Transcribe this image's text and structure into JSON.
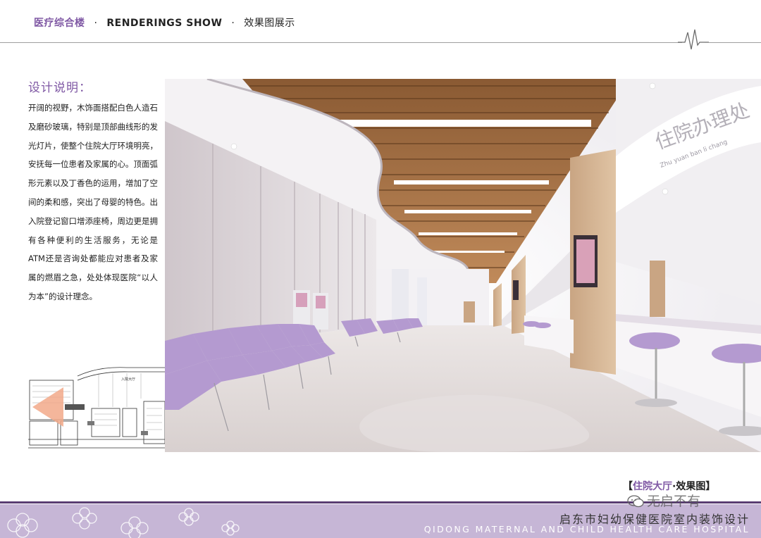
{
  "header": {
    "section_cn": "医疗综合楼",
    "sep1": "·",
    "section_en": "RENDERINGS SHOW",
    "sep2": "·",
    "section_view": "效果图展示"
  },
  "description": {
    "title": "设计说明：",
    "body": "开阔的视野，木饰面搭配白色人造石及磨砂玻璃，特别是顶部曲线形的发光灯片，使整个住院大厅环境明亮，安抚每一位患者及家属的心。顶面弧形元素以及丁香色的运用，增加了空间的柔和感，突出了母婴的特色。出入院登记窗口增添座椅，周边更是拥有各种便利的生活服务，无论是ATM还是咨询处都能应对患者及家属的燃眉之急，处处体现医院“以人为本”的设计理念。"
  },
  "floor_plan": {
    "label": "入院大厅"
  },
  "rendering": {
    "wall_sign": "住院办理处",
    "wall_sign_sub": "Zhu yuan ban li chang"
  },
  "caption": {
    "open": "【",
    "accent": "住院大厅",
    "rest": "·效果图",
    "close": "】"
  },
  "watermark": "无启不有",
  "footer": {
    "title_cn": "启东市妇幼保健医院室内装饰设计",
    "title_en": "QIDONG MATERNAL AND CHILD HEALTH CARE HOSPITAL"
  },
  "colors": {
    "accent": "#7f58a4",
    "lilac": "#c6b6d6",
    "seat": "#b49ad0"
  }
}
